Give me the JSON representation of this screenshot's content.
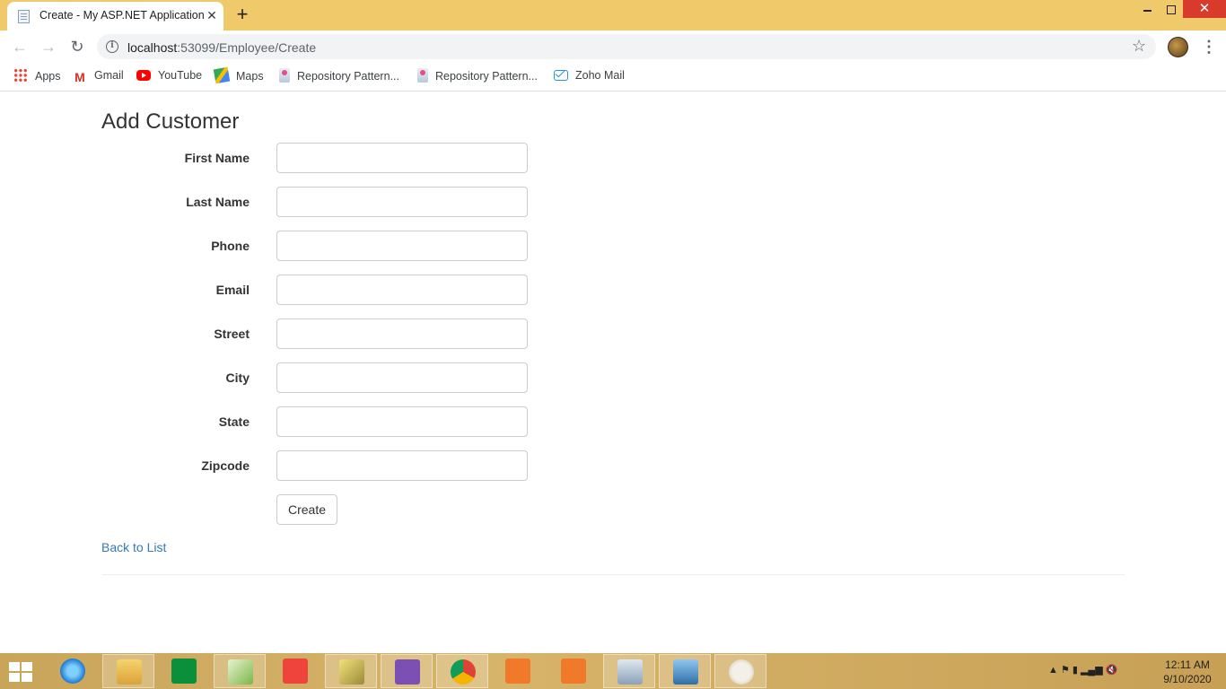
{
  "browser": {
    "tab_title": "Create - My ASP.NET Application",
    "url_host": "localhost",
    "url_rest": ":53099/Employee/Create",
    "bookmarks": [
      {
        "label": "Apps",
        "icon": "apps-grid-icon"
      },
      {
        "label": "Gmail",
        "icon": "gmail-icon"
      },
      {
        "label": "YouTube",
        "icon": "youtube-icon"
      },
      {
        "label": "Maps",
        "icon": "maps-icon"
      },
      {
        "label": "Repository Pattern...",
        "icon": "page-favicon-icon"
      },
      {
        "label": "Repository Pattern...",
        "icon": "page-favicon-icon"
      },
      {
        "label": "Zoho Mail",
        "icon": "zoho-mail-icon"
      }
    ]
  },
  "page": {
    "title": "Add Customer",
    "fields": [
      {
        "label": "First Name",
        "value": ""
      },
      {
        "label": "Last Name",
        "value": ""
      },
      {
        "label": "Phone",
        "value": ""
      },
      {
        "label": "Email",
        "value": ""
      },
      {
        "label": "Street",
        "value": ""
      },
      {
        "label": "City",
        "value": ""
      },
      {
        "label": "State",
        "value": ""
      },
      {
        "label": "Zipcode",
        "value": ""
      }
    ],
    "create_label": "Create",
    "back_link": "Back to List"
  },
  "taskbar": {
    "apps": [
      "internet-explorer",
      "file-explorer",
      "store",
      "notepad-plus-plus",
      "anydesk",
      "tools",
      "visual-studio",
      "chrome",
      "screenshot-tool",
      "camera-tool",
      "performance-monitor",
      "photo-viewer",
      "paint"
    ],
    "time": "12:11 AM",
    "date": "9/10/2020"
  },
  "colors": {
    "titlebar": "#f0c96a",
    "link": "#337ab7",
    "close_button": "#d83b2c"
  }
}
